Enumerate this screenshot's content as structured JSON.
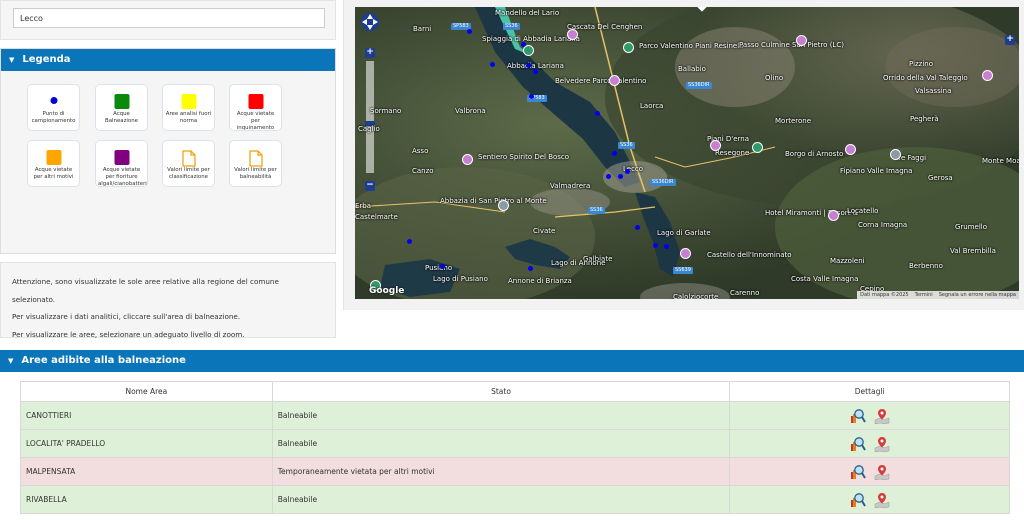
{
  "search": {
    "value": "Lecco"
  },
  "legend": {
    "title": "Legenda",
    "items": [
      {
        "label": "Punto di campionamento",
        "kind": "dot",
        "color": "#0000dd"
      },
      {
        "label": "Acque Balneazione",
        "kind": "square",
        "color": "#0a8a0a"
      },
      {
        "label": "Aree analisi fuori norma",
        "kind": "square",
        "color": "#ffff00"
      },
      {
        "label": "Acque vietate per inquinamento",
        "kind": "square",
        "color": "#ff0000"
      },
      {
        "label": "Acque vietate per altri motivi",
        "kind": "square",
        "color": "#ffa500"
      },
      {
        "label": "Acque vietate per fioriture algali/cianobatteri",
        "kind": "square",
        "color": "#800080"
      },
      {
        "label": "Valori limite per classificazione",
        "kind": "document",
        "color": "#f0a000"
      },
      {
        "label": "Valori limite per balneabilità",
        "kind": "document",
        "color": "#f0a000"
      }
    ]
  },
  "notes": [
    "Attenzione, sono visualizzate le sole aree relative alla regione del comune selezionato.",
    "Per visualizzare i dati analitici, cliccare sull'area di balneazione.",
    "Per visualizzare le aree, selezionare un adeguato livello di zoom."
  ],
  "map": {
    "labels": [
      "Barni",
      "Spiaggia di Abbadia Lariana",
      "Abbadia Lariana",
      "Cascata Del Cenghen",
      "Parco Valentino Piani Resinelli",
      "Passo Culmine San Pietro (LC)",
      "Pizzino",
      "Orrido della Val Taleggio",
      "Ballabio",
      "Belvedere Parco Valentino",
      "Olino",
      "Sormano",
      "Valbrona",
      "Laorca",
      "Pegherà",
      "Morterone",
      "Caglio",
      "Piani D'erna",
      "Resegone",
      "Borgo di Arnosto",
      "Fipiano Valle Imagna",
      "Tre Faggi",
      "Asso",
      "Sentiero Spirito Del Bosco",
      "Canzo",
      "Lecco",
      "Valmadrera",
      "Gerosa",
      "Monte Moa",
      "Abbazia di San Pietro al Monte",
      "Hotel Miramonti | Resort &",
      "Locatello",
      "Corna Imagna",
      "Grumello",
      "Erba",
      "Castelmarte",
      "Civate",
      "Galbiate",
      "Lago di Annone",
      "Lago di Garlate",
      "Castello dell'Innominato",
      "Mazzoleni",
      "Val Brembilla",
      "Pusiano",
      "Berbenno",
      "Costa Valle Imagna",
      "Annone di Brianza",
      "Lago di Pusiano",
      "Carenno",
      "Calolziocorte",
      "Cepino",
      "Valsassina",
      "Mandello del Lario"
    ],
    "shields": [
      "SP583",
      "SS36",
      "SP583",
      "SS36DIR",
      "SS36",
      "SS36DIR",
      "SS36",
      "SS639"
    ],
    "google": "Google",
    "attribution": [
      "Dati mappa ©2025",
      "Termini",
      "Segnala un errore nella mappa"
    ],
    "zoom_in": "+",
    "zoom_out": "−"
  },
  "aree": {
    "title": "Aree adibite alla balneazione",
    "columns": [
      "Nome Area",
      "Stato",
      "Dettagli"
    ],
    "rows": [
      {
        "name": "CANOTTIERI",
        "stato": "Balneabile",
        "status": "ok"
      },
      {
        "name": "LOCALITA' PRADELLO",
        "stato": "Balneabile",
        "status": "ok"
      },
      {
        "name": "MALPENSATA",
        "stato": "Temporaneamente vietata per altri motivi",
        "status": "bad"
      },
      {
        "name": "RIVABELLA",
        "stato": "Balneabile",
        "status": "ok"
      }
    ]
  },
  "colors": {
    "header_blue": "#0a75b8",
    "ok_row": "#dff0d8",
    "bad_row": "#f2dede"
  }
}
